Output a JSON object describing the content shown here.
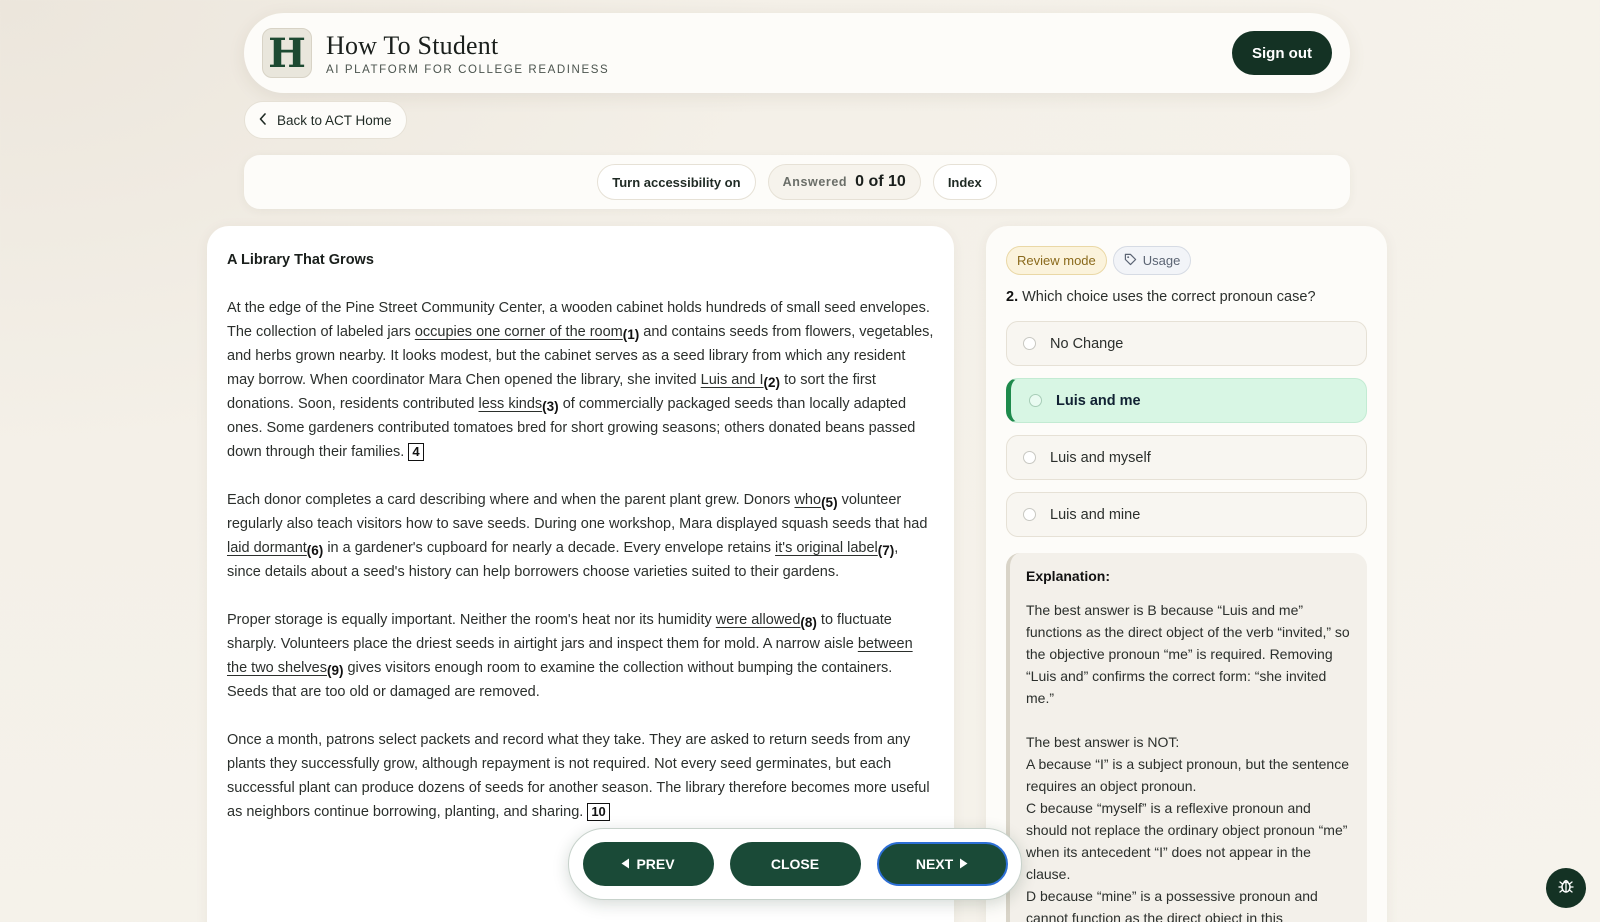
{
  "header": {
    "logo_letter": "H",
    "title": "How To Student",
    "subtitle": "AI PLATFORM FOR COLLEGE READINESS",
    "signout_label": "Sign out"
  },
  "nav": {
    "back_label": "Back to ACT Home"
  },
  "toolbar": {
    "accessibility_label": "Turn accessibility on",
    "answered_label": "Answered",
    "answered_value": "0 of 10",
    "index_label": "Index"
  },
  "passage": {
    "title": "A Library That Grows",
    "p1": {
      "a": "At the edge of the Pine Street Community Center, a wooden cabinet holds hundreds of small seed envelopes. The collection of labeled jars ",
      "u1": "occupies one corner of the room",
      "n1": "(1)",
      "b": " and contains seeds from flowers, vegetables, and herbs grown nearby. It looks modest, but the cabinet serves as a seed library from which any resident may borrow. When coordinator Mara Chen opened the library, she invited ",
      "u2": "Luis and I",
      "n2": "(2)",
      "c": " to sort the first donations. Soon, residents contributed ",
      "u3": "less kinds",
      "n3": "(3)",
      "d": " of commercially packaged seeds than locally adapted ones. Some gardeners contributed tomatoes bred for short growing seasons; others donated beans passed down through their families. ",
      "box": "4"
    },
    "p2": {
      "a": "Each donor completes a card describing where and when the parent plant grew. Donors ",
      "u5": "who",
      "n5": "(5)",
      "b": " volunteer regularly also teach visitors how to save seeds. During one workshop, Mara displayed squash seeds that had ",
      "u6": "laid dormant",
      "n6": "(6)",
      "c": " in a gardener's cupboard for nearly a decade. Every envelope retains ",
      "u7": "it's original label",
      "n7": "(7)",
      "d": ", since details about a seed's history can help borrowers choose varieties suited to their gardens."
    },
    "p3": {
      "a": "Proper storage is equally important. Neither the room's heat nor its humidity ",
      "u8": "were allowed",
      "n8": "(8)",
      "b": " to fluctuate sharply. Volunteers place the driest seeds in airtight jars and inspect them for mold. A narrow aisle ",
      "u9": "between the two shelves",
      "n9": "(9)",
      "c": " gives visitors enough room to examine the collection without bumping the containers. Seeds that are too old or damaged are removed."
    },
    "p4": {
      "a": "Once a month, patrons select packets and record what they take. They are asked to return seeds from any plants they successfully grow, although repayment is not required. Not every seed germinates, but each successful plant can produce dozens of seeds for another season. The library therefore becomes more useful as neighbors continue borrowing, planting, and sharing. ",
      "box": "10"
    }
  },
  "question_panel": {
    "review_tag": "Review mode",
    "usage_tag": "Usage",
    "question_number": "2.",
    "question_text": "Which choice uses the correct pronoun case?",
    "choices": [
      {
        "label": "No Change",
        "selected": false
      },
      {
        "label": "Luis and me",
        "selected": true
      },
      {
        "label": "Luis and myself",
        "selected": false
      },
      {
        "label": "Luis and mine",
        "selected": false
      }
    ],
    "explanation": {
      "title": "Explanation:",
      "body": "The best answer is B because “Luis and me” functions as the direct object of the verb “invited,” so the objective pronoun “me” is required. Removing “Luis and” confirms the correct form: “she invited me.”",
      "not_heading": "The best answer is NOT:",
      "a": "A because “I” is a subject pronoun, but the sentence requires an object pronoun.",
      "c": "C because “myself” is a reflexive pronoun and should not replace the ordinary object pronoun “me” when its antecedent “I” does not appear in the clause.",
      "d": "D because “mine” is a possessive pronoun and cannot function as the direct object in this"
    }
  },
  "bottom_nav": {
    "prev_label": "PREV",
    "close_label": "CLOSE",
    "next_label": "NEXT"
  },
  "colors": {
    "brand_dark": "#143224",
    "button_green": "#1a4a37",
    "selected_bg": "#d8f6e4",
    "selected_accent": "#1e8a4c",
    "review_tag": "#fbf3dc"
  }
}
